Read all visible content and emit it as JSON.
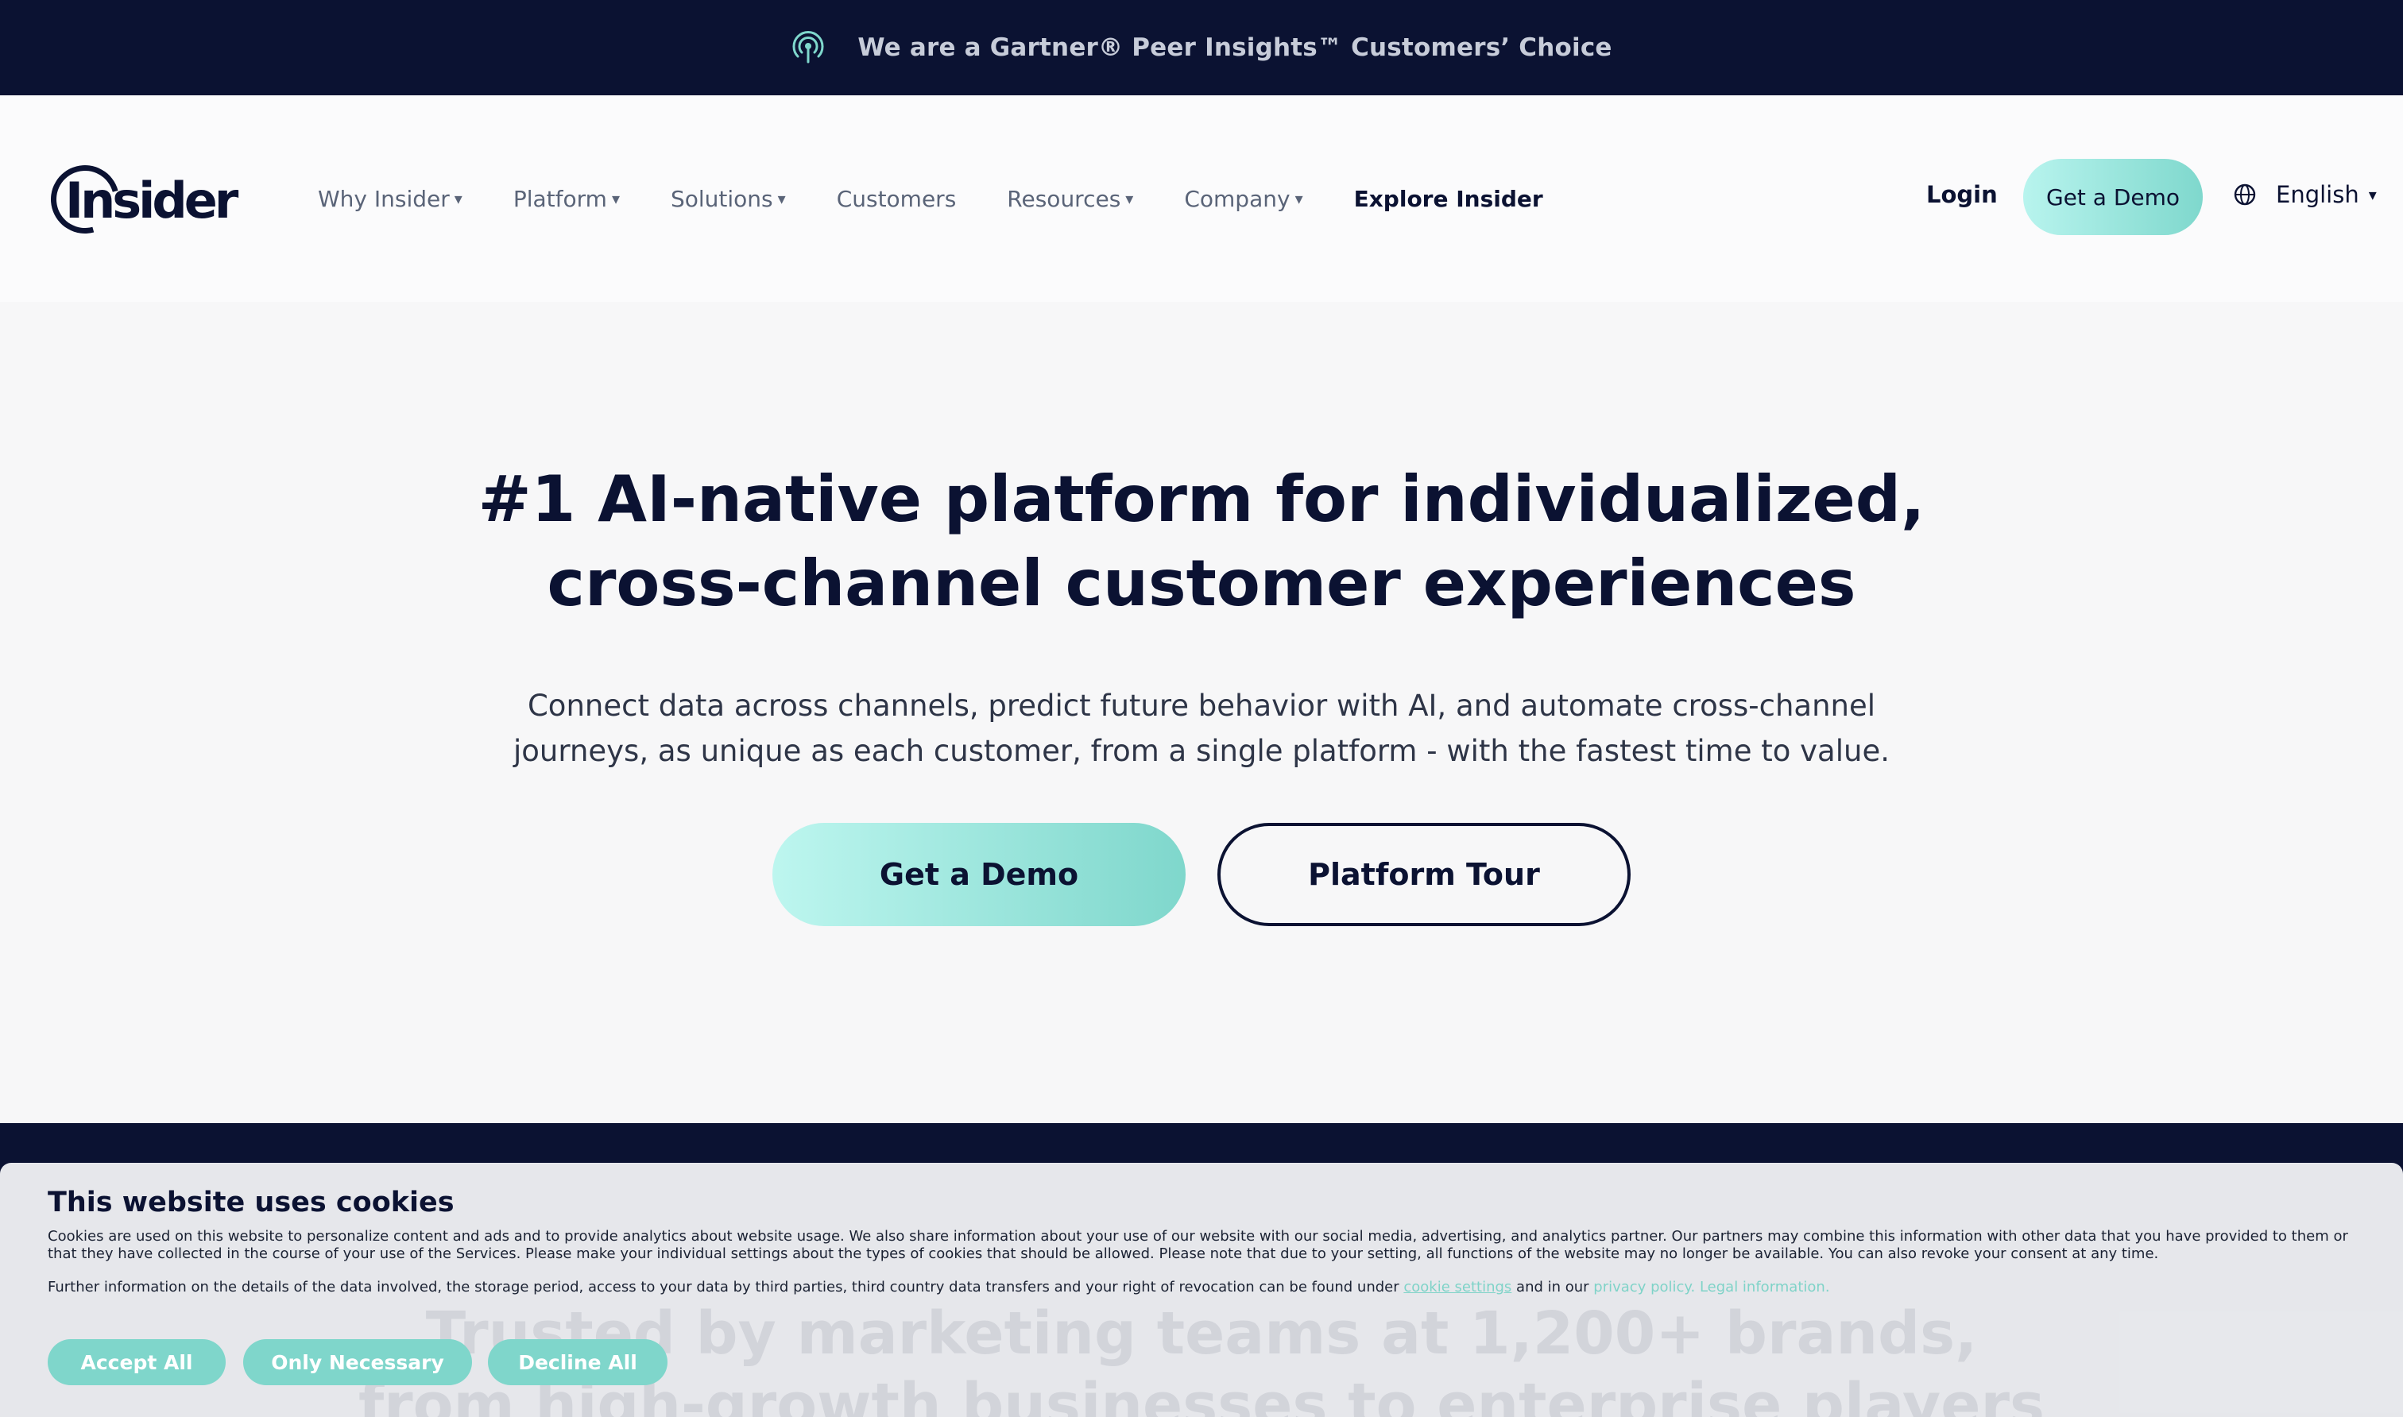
{
  "announcement": {
    "text": "We are a Gartner® Peer Insights™ Customers’ Choice",
    "icon": "signal-icon"
  },
  "header": {
    "logo_text": "Insider",
    "menu": [
      {
        "label": "Why Insider",
        "caret": "▾"
      },
      {
        "label": "Platform",
        "caret": "▾"
      },
      {
        "label": "Solutions",
        "caret": "▾"
      },
      {
        "label": "Customers",
        "caret": ""
      },
      {
        "label": "Resources",
        "caret": "▾"
      },
      {
        "label": "Company",
        "caret": "▾"
      },
      {
        "label": "Explore Insider",
        "caret": ""
      }
    ],
    "login": "Login",
    "demo_button": "Get a Demo",
    "language": "English",
    "language_caret": "▾"
  },
  "hero": {
    "title_line1": "#1 AI-native platform for individualized,",
    "title_line2": "cross-channel customer experiences",
    "subtitle": "Connect data across channels, predict future behavior with AI, and automate cross-channel journeys, as unique as each customer, from a single platform - with the fastest time to value.",
    "primary_button": "Get a Demo",
    "secondary_button": "Platform Tour"
  },
  "trusted": {
    "line1": "Trusted by marketing teams at 1,200+ brands,",
    "line2": "from high-growth businesses to enterprise players"
  },
  "cookie_banner": {
    "title": "This website uses cookies",
    "paragraph1": "Cookies are used on this website to personalize content and ads and to provide analytics about website usage. We also share information about your use of our website with our social media, advertising, and analytics partner. Our partners may combine this information with other data that you have provided to them or that they have collected in the course of your use of the Services. Please make your individual settings about the types of cookies that should be allowed. Please note that due to your setting, all functions of the website may no longer be available. You can also revoke your consent at any time.",
    "paragraph2_prefix": "Further information on the details of the data involved, the storage period, access to your data by third parties, third country data transfers and your right of revocation can be found under ",
    "cookie_settings_link": "cookie settings",
    "paragraph2_mid": " and in our ",
    "privacy_link": "privacy policy.",
    "legal_link": "Legal information.",
    "accept_all": "Accept All",
    "only_necessary": "Only Necessary",
    "decline_all": "Decline All"
  },
  "colors": {
    "navy": "#0b1232",
    "accent_teal": "#7fd8cd",
    "accent_teal_light": "#b8f4ee",
    "background": "#f7f7f8"
  }
}
